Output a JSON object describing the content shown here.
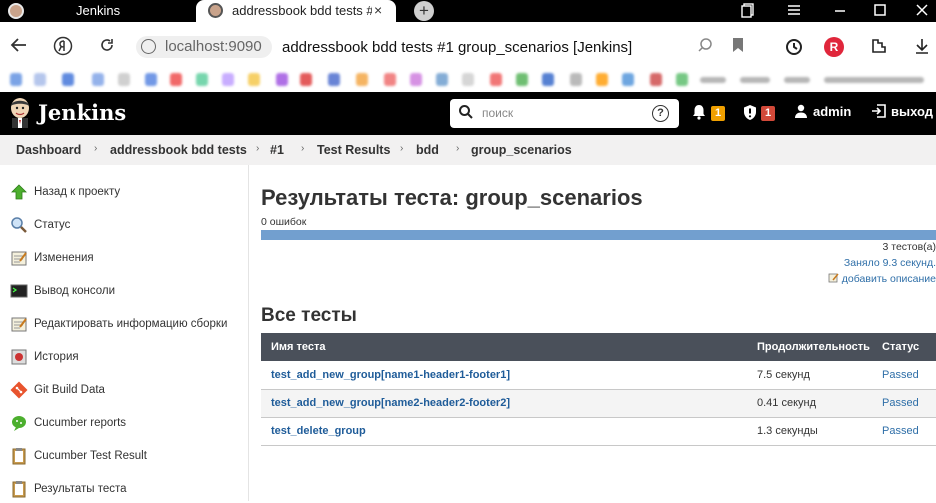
{
  "browser": {
    "tabs": [
      {
        "label": "Jenkins"
      },
      {
        "label": "addressbook bdd tests #1"
      }
    ],
    "tab_close": "×",
    "new_tab": "+",
    "address": {
      "host": "localhost:9090",
      "page_title": "addressbook bdd tests #1 group_scenarios [Jenkins]"
    }
  },
  "header": {
    "brand": "Jenkins",
    "search_placeholder": "поиск",
    "notifications_count": "1",
    "security_count": "1",
    "user": "admin",
    "logout": "выход",
    "colors": {
      "notif_badge": "#f0a000",
      "security_badge": "#d24939"
    }
  },
  "breadcrumbs": [
    "Dashboard",
    "addressbook bdd tests",
    "#1",
    "Test Results",
    "bdd",
    "group_scenarios"
  ],
  "sidebar": {
    "items": [
      {
        "label": "Назад к проекту",
        "icon": "up-arrow-icon"
      },
      {
        "label": "Статус",
        "icon": "magnifier-icon"
      },
      {
        "label": "Изменения",
        "icon": "notepad-icon"
      },
      {
        "label": "Вывод консоли",
        "icon": "terminal-icon"
      },
      {
        "label": "Редактировать информацию сборки",
        "icon": "notepad-edit-icon"
      },
      {
        "label": "История",
        "icon": "history-icon"
      },
      {
        "label": "Git Build Data",
        "icon": "git-icon"
      },
      {
        "label": "Cucumber reports",
        "icon": "cucumber-icon"
      },
      {
        "label": "Cucumber Test Result",
        "icon": "clipboard-icon"
      },
      {
        "label": "Результаты теста",
        "icon": "clipboard-icon"
      }
    ]
  },
  "main": {
    "title": "Результаты теста: group_scenarios",
    "fail_count": "0 ошибок",
    "test_count": "3 тестов(а)",
    "duration": "Заняло 9.3 секунд.",
    "add_description": "добавить описание",
    "all_tests_heading": "Все тесты",
    "table": {
      "headers": [
        "Имя теста",
        "Продолжительность",
        "Статус"
      ],
      "rows": [
        {
          "name": "test_add_new_group[name1-header1-footer1]",
          "duration": "7.5 секунд",
          "status": "Passed"
        },
        {
          "name": "test_add_new_group[name2-header2-footer2]",
          "duration": "0.41 секунд",
          "status": "Passed"
        },
        {
          "name": "test_delete_group",
          "duration": "1.3 секунды",
          "status": "Passed"
        }
      ]
    }
  }
}
